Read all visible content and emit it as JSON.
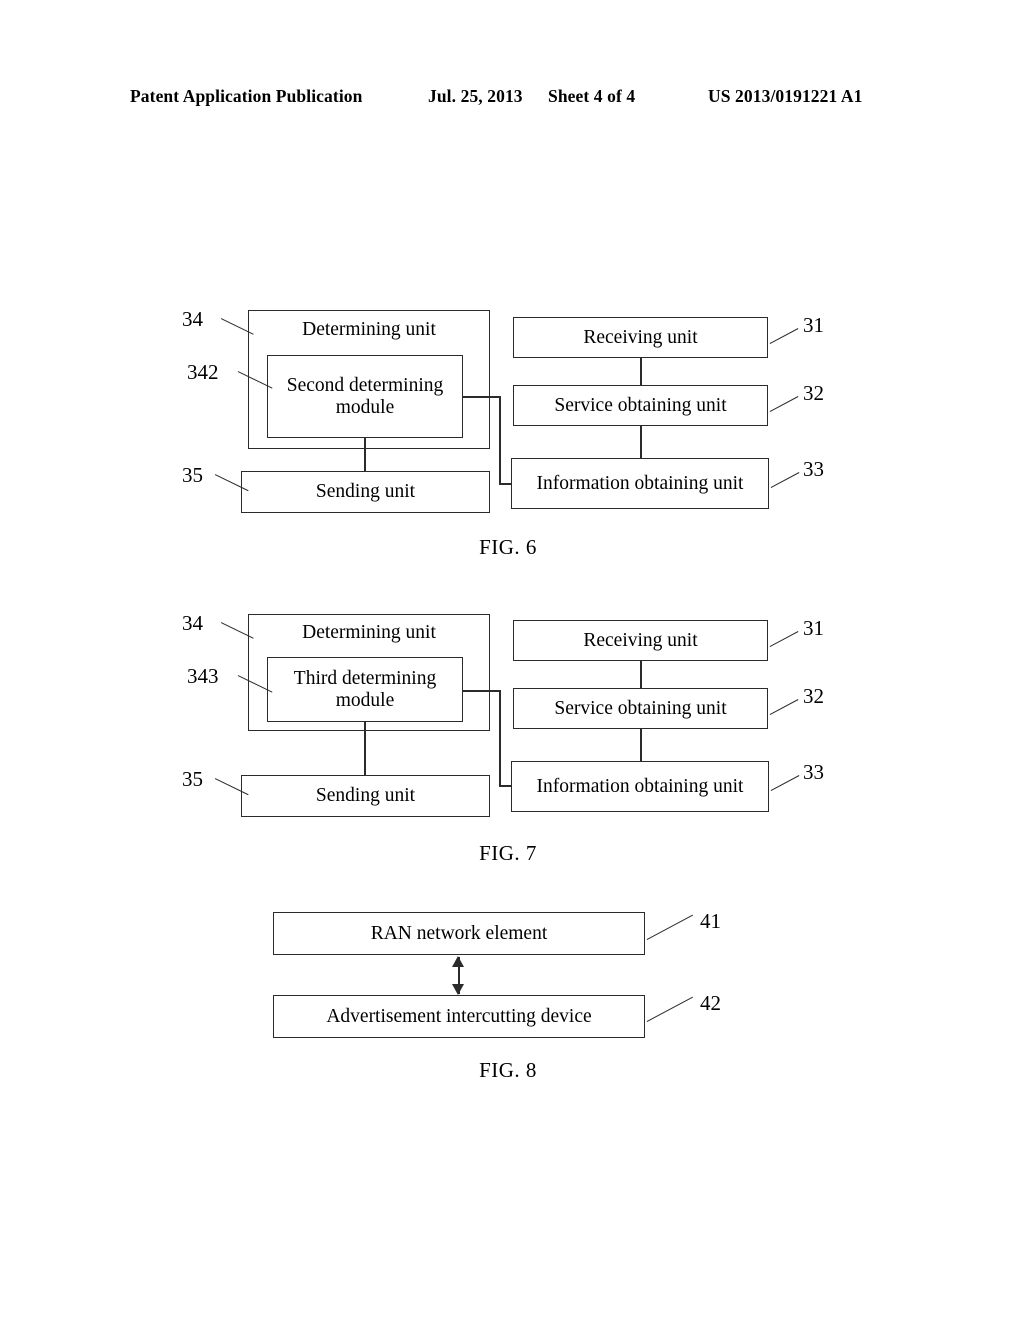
{
  "header": {
    "publication": "Patent Application Publication",
    "date": "Jul. 25, 2013",
    "sheet": "Sheet 4 of 4",
    "patent_number": "US 2013/0191221 A1"
  },
  "figures": [
    {
      "caption": "FIG. 6",
      "blocks": {
        "determining_unit": "Determining unit",
        "inner_module": "Second determining module",
        "sending_unit": "Sending unit",
        "receiving_unit": "Receiving unit",
        "service_obtaining_unit": "Service obtaining unit",
        "information_obtaining_unit": "Information obtaining unit"
      },
      "refs": {
        "determining_unit": "34",
        "inner_module": "342",
        "sending_unit": "35",
        "receiving_unit": "31",
        "service_obtaining_unit": "32",
        "information_obtaining_unit": "33"
      }
    },
    {
      "caption": "FIG. 7",
      "blocks": {
        "determining_unit": "Determining unit",
        "inner_module": "Third determining module",
        "sending_unit": "Sending unit",
        "receiving_unit": "Receiving unit",
        "service_obtaining_unit": "Service obtaining unit",
        "information_obtaining_unit": "Information obtaining unit"
      },
      "refs": {
        "determining_unit": "34",
        "inner_module": "343",
        "sending_unit": "35",
        "receiving_unit": "31",
        "service_obtaining_unit": "32",
        "information_obtaining_unit": "33"
      }
    },
    {
      "caption": "FIG. 8",
      "blocks": {
        "ran_network_element": "RAN network element",
        "advertisement_device": "Advertisement intercutting device"
      },
      "refs": {
        "ran_network_element": "41",
        "advertisement_device": "42"
      }
    }
  ]
}
